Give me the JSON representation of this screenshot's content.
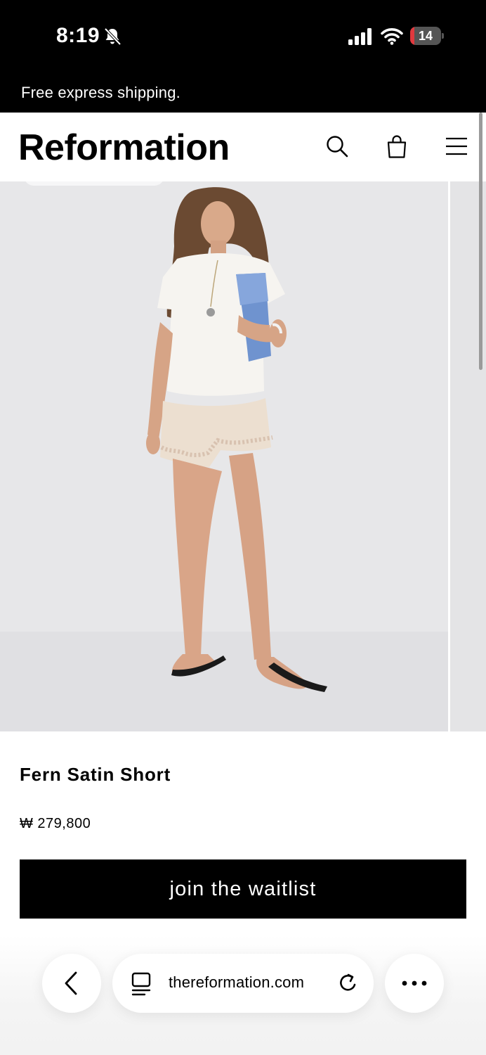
{
  "status_bar": {
    "time": "8:19",
    "battery_level": "14",
    "battery_fraction": 0.14,
    "icons": [
      "bell-slash-icon",
      "cellular-signal-icon",
      "wifi-icon",
      "battery-icon"
    ]
  },
  "promo": {
    "text": "Free express shipping."
  },
  "header": {
    "logo": "Reformation",
    "icons": [
      "search-icon",
      "shopping-bag-icon",
      "hamburger-menu-icon"
    ]
  },
  "product": {
    "name": "Fern Satin Short",
    "price": "₩ 279,800",
    "cta_label": "join the waitlist"
  },
  "browser": {
    "url": "thereformation.com",
    "icons": [
      "back-chevron-icon",
      "tabs-icon",
      "reload-icon",
      "more-dots-icon"
    ]
  },
  "colors": {
    "black": "#000000",
    "white": "#ffffff",
    "photo_background": "#e7e7e9",
    "battery_low": "#e0393e"
  }
}
